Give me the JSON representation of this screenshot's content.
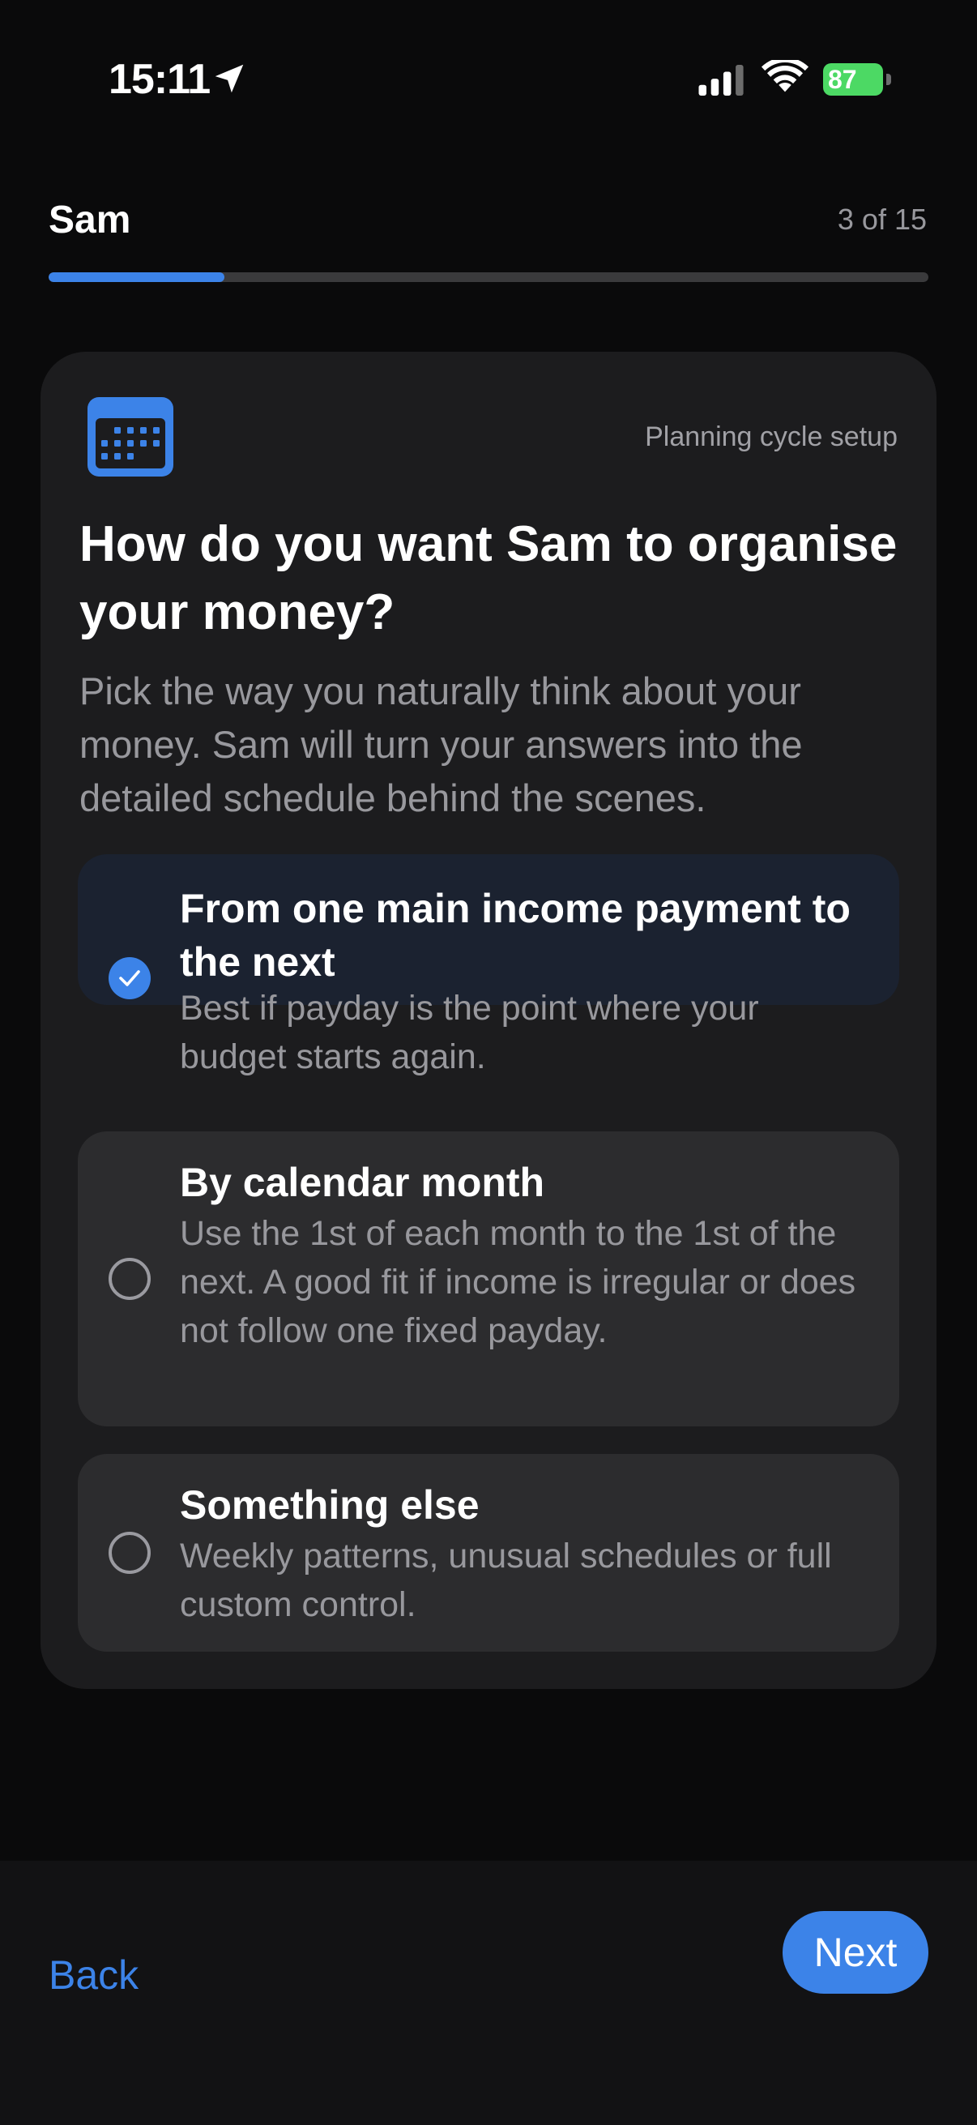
{
  "status_bar": {
    "time": "15:11",
    "battery": "87",
    "icons": [
      "location-arrow-icon",
      "cellular-signal-icon",
      "wifi-icon",
      "battery-icon"
    ],
    "battery_color": "#4cd964"
  },
  "header": {
    "title": "Sam",
    "step": "3 of 15",
    "progress": 0.2
  },
  "card": {
    "icon": "calendar-icon",
    "tag": "Planning cycle setup",
    "title": "How do you want Sam to organise your money?",
    "description": "Pick the way you naturally think about your money. Sam will turn your answers into the detailed schedule behind the scenes.",
    "options": [
      {
        "title": "From one main income payment to the next",
        "subtitle": "Best if payday is the point where your budget starts again.",
        "selected": true
      },
      {
        "title": "By calendar month",
        "subtitle": "Use the 1st of each month to the 1st of the next. A good fit if income is irregular or does not follow one fixed payday.",
        "selected": false
      },
      {
        "title": "Something else",
        "subtitle": "Weekly patterns, unusual schedules or full custom control.",
        "selected": false
      }
    ]
  },
  "footer": {
    "back_label": "Back",
    "next_label": "Next"
  },
  "colors": {
    "accent": "#3c83e8",
    "background": "#0a0a0b",
    "card": "#1c1c1e",
    "option": "#2c2c2e",
    "option_selected": "#1b2230"
  }
}
